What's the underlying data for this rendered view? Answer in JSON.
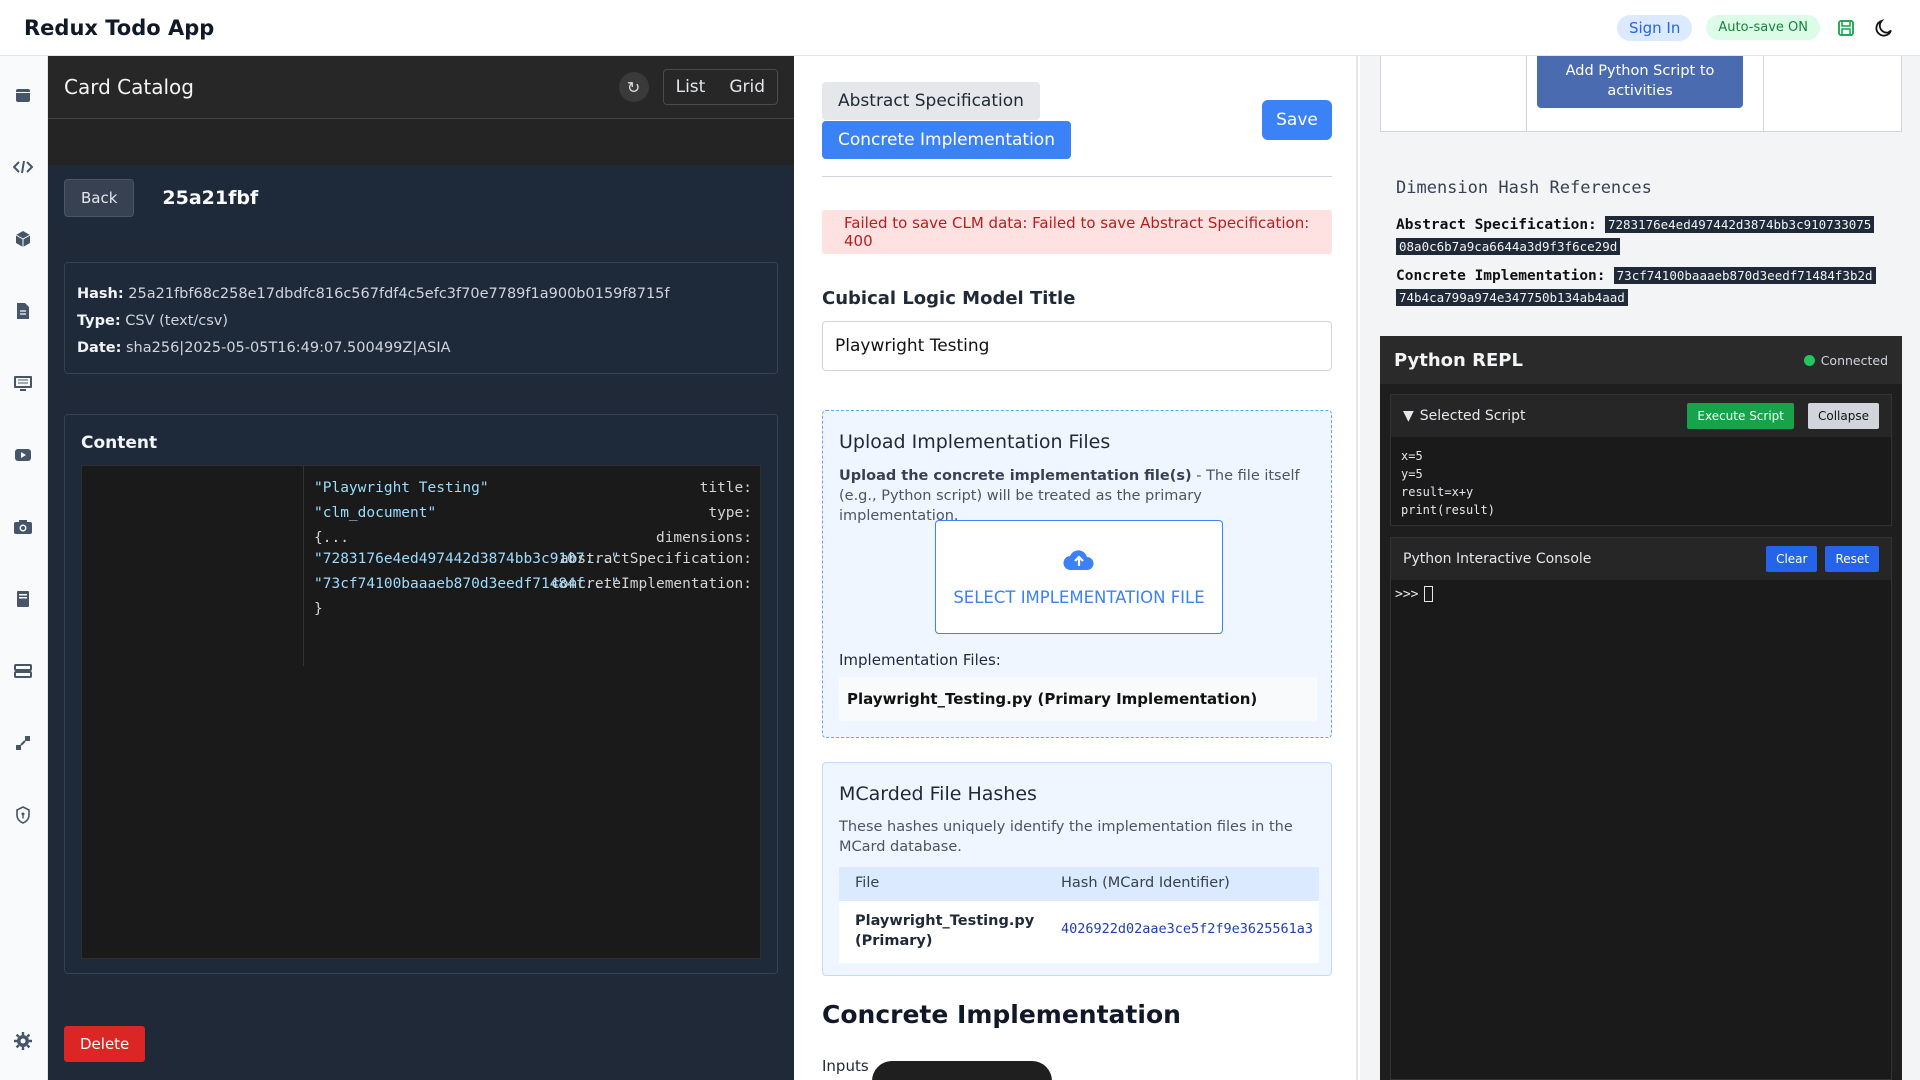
{
  "header": {
    "app_title": "Redux Todo App",
    "sign_in": "Sign In",
    "autosave": "Auto-save ON"
  },
  "rail_icons": [
    "calendar-icon",
    "code-icon",
    "cube-icon",
    "file-icon",
    "monitor-icon",
    "video-icon",
    "camera-icon",
    "book-icon",
    "stack-icon",
    "network-icon",
    "shield-icon",
    "gear-icon"
  ],
  "catalog": {
    "title": "Card Catalog",
    "refresh": "↻",
    "view_list": "List",
    "view_grid": "Grid",
    "back": "Back",
    "card_id": "25a21fbf",
    "meta": {
      "hash_label": "Hash:",
      "hash_value": "25a21fbf68c258e17dbdfc816c567fdf4c5efc3f70e7789f1a900b0159f8715f",
      "type_label": "Type:",
      "type_value": "CSV (text/csv)",
      "date_label": "Date:",
      "date_value": "sha256|2025-05-05T16:49:07.500499Z|ASIA"
    },
    "content_title": "Content",
    "json_rows": [
      {
        "key": "title:",
        "value": "\"Playwright Testing\""
      },
      {
        "key": "type:",
        "value": "\"clm_document\""
      },
      {
        "key": "dimensions:",
        "value": "{..."
      },
      {
        "key": "abstractSpecification:",
        "value": "\"7283176e4ed497442d3874bb3c9107...\""
      },
      {
        "key": "concreteImplementation:",
        "value": "\"73cf74100baaaeb870d3eedf71484f...\""
      },
      {
        "key": "",
        "value": "}"
      }
    ],
    "delete": "Delete"
  },
  "editor": {
    "tab_abstract": "Abstract Specification",
    "tab_concrete": "Concrete Implementation",
    "save": "Save",
    "error": "Failed to save CLM data: Failed to save Abstract Specification: 400",
    "title_label": "Cubical Logic Model Title",
    "title_value": "Playwright Testing",
    "upload": {
      "title": "Upload Implementation Files",
      "desc_bold": "Upload the concrete implementation file(s)",
      "desc_rest": " - The file itself (e.g., Python script) will be treated as the primary implementation.",
      "select_button": "SELECT IMPLEMENTATION FILE",
      "files_label": "Implementation Files:",
      "file_name": "Playwright_Testing.py (Primary Implementation)"
    },
    "hashes": {
      "title": "MCarded File Hashes",
      "desc": "These hashes uniquely identify the implementation files in the MCard database.",
      "col_file": "File",
      "col_hash": "Hash (MCard Identifier)",
      "row_file_line1": "Playwright_Testing.py",
      "row_file_line2": "(Primary)",
      "row_hash": "4026922d02aae3ce5f2f9e3625561a3"
    },
    "concrete_heading": "Concrete Implementation",
    "inputs_label": "Inputs"
  },
  "right": {
    "add_script_button": "Add Python Script to activities",
    "dim_title": "Dimension Hash References",
    "abs_label": "Abstract Specification:",
    "abs_hash_1": "7283176e4ed497442d3874bb3c910733075",
    "abs_hash_2": "08a0c6b7a9ca6644a3d9f3f6ce29d",
    "con_label": "Concrete Implementation:",
    "con_hash_1": "73cf74100baaaeb870d3eedf71484f3b2d",
    "con_hash_2": "74b4ca799a974e347750b134ab4aad",
    "repl": {
      "title": "Python REPL",
      "status": "Connected",
      "script_title": "Selected Script",
      "toggle": "▼",
      "execute": "Execute Script",
      "collapse": "Collapse",
      "code": [
        "x=5",
        "y=5",
        "result=x+y",
        "print(result)"
      ],
      "console_title": "Python Interactive Console",
      "clear": "Clear",
      "reset": "Reset",
      "prompt": ">>>"
    }
  },
  "colors": {
    "accent": "#3b82f6",
    "error_bg": "#fee2e2",
    "danger": "#dc2626",
    "success": "#16a34a"
  }
}
